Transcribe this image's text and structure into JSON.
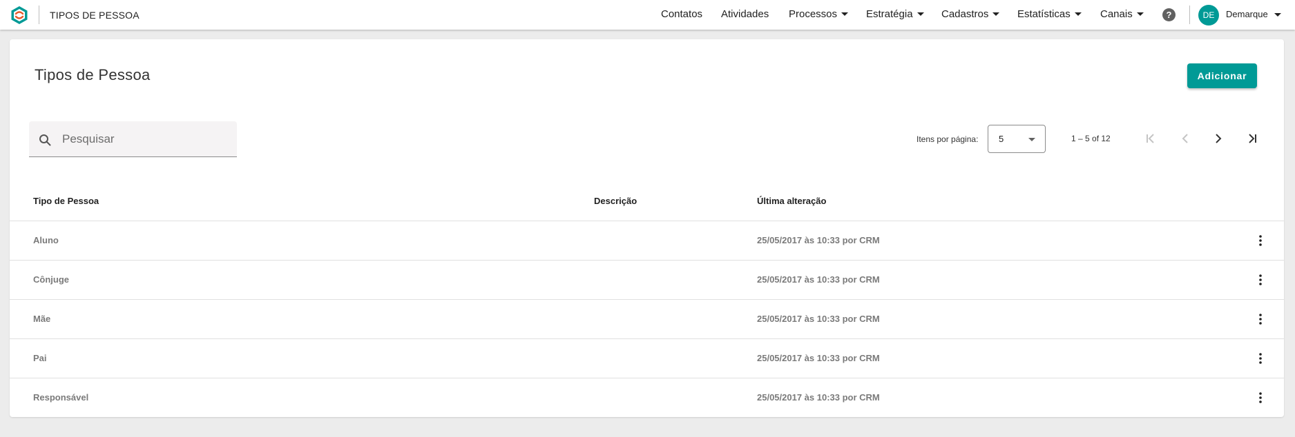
{
  "app": {
    "title": "TIPOS DE PESSOA",
    "logo_icon": "hexagon-logo-icon",
    "accent": "#009a96"
  },
  "nav": [
    {
      "label": "Contatos",
      "dropdown": false
    },
    {
      "label": "Atividades",
      "dropdown": false
    },
    {
      "label": "Processos",
      "dropdown": true
    },
    {
      "label": "Estratégia",
      "dropdown": true
    },
    {
      "label": "Cadastros",
      "dropdown": true
    },
    {
      "label": "Estatísticas",
      "dropdown": true
    },
    {
      "label": "Canais",
      "dropdown": true
    }
  ],
  "user": {
    "initials": "DE",
    "name": "Demarque",
    "help_icon": "?"
  },
  "page": {
    "title": "Tipos de Pessoa",
    "add_label": "Adicionar"
  },
  "search": {
    "placeholder": "Pesquisar",
    "value": ""
  },
  "pagination": {
    "items_per_page_label": "Itens por página:",
    "items_per_page": "5",
    "range": "1 – 5 of 12"
  },
  "table": {
    "headers": [
      "Tipo de Pessoa",
      "Descrição",
      "Última alteração"
    ],
    "rows": [
      {
        "tipo": "Aluno",
        "descricao": "",
        "alteracao": "25/05/2017 às 10:33 por CRM"
      },
      {
        "tipo": "Cônjuge",
        "descricao": "",
        "alteracao": "25/05/2017 às 10:33 por CRM"
      },
      {
        "tipo": "Mãe",
        "descricao": "",
        "alteracao": "25/05/2017 às 10:33 por CRM"
      },
      {
        "tipo": "Pai",
        "descricao": "",
        "alteracao": "25/05/2017 às 10:33 por CRM"
      },
      {
        "tipo": "Responsável",
        "descricao": "",
        "alteracao": "25/05/2017 às 10:33 por CRM"
      }
    ]
  }
}
